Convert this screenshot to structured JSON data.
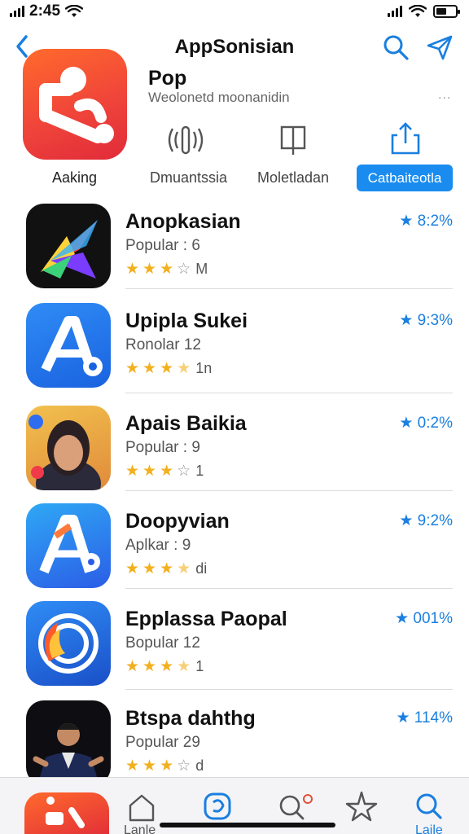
{
  "status_bar": {
    "time": "2:45"
  },
  "nav": {
    "title": "AppSonisian"
  },
  "header": {
    "app_name": "Pop",
    "subtitle": "Weolonetd moonanidin",
    "more": "..."
  },
  "categories": [
    {
      "label": "Aaking",
      "icon": "app-icon"
    },
    {
      "label": "Dmuantssia",
      "icon": "podcast-icon"
    },
    {
      "label": "Moletladan",
      "icon": "book-icon"
    },
    {
      "label": "Catbaiteotla",
      "icon": "share-icon",
      "active": true
    }
  ],
  "apps": [
    {
      "title": "Anopkasian",
      "subtitle": "Popular : 6",
      "stars": 3,
      "suffix": "M",
      "rating": "★ 8:2%"
    },
    {
      "title": "Upipla Sukei",
      "subtitle": "Ronolar 12",
      "stars": 3.5,
      "suffix": "1n",
      "rating": "★ 9:3%"
    },
    {
      "title": "Apais Baikia",
      "subtitle": "Popular : 9",
      "stars": 3,
      "suffix": "1",
      "rating": "★ 0:2%"
    },
    {
      "title": "Doopyvian",
      "subtitle": "Aplkar : 9",
      "stars": 3.5,
      "suffix": "di",
      "rating": "★ 9:2%"
    },
    {
      "title": "Epplassa Paopal",
      "subtitle": "Bopular 12",
      "stars": 3.5,
      "suffix": "1",
      "rating": "★ 001%"
    },
    {
      "title": "Btspa dahthg",
      "subtitle": "Popular 29",
      "stars": 3,
      "suffix": "d",
      "rating": "★ 114%"
    }
  ],
  "tabs": [
    {
      "label": "",
      "icon": "app-icon"
    },
    {
      "label": "Lanle",
      "icon": "home-icon"
    },
    {
      "label": "",
      "icon": "apps-icon"
    },
    {
      "label": "",
      "icon": "search-notify-icon"
    },
    {
      "label": "",
      "icon": "star-icon"
    },
    {
      "label": "Laile",
      "icon": "search-icon",
      "active": true
    }
  ],
  "colors": {
    "accent": "#1a7fe0",
    "star": "#f2b01e",
    "hero_icon": "#f0453a",
    "button": "#1a8cf0"
  }
}
